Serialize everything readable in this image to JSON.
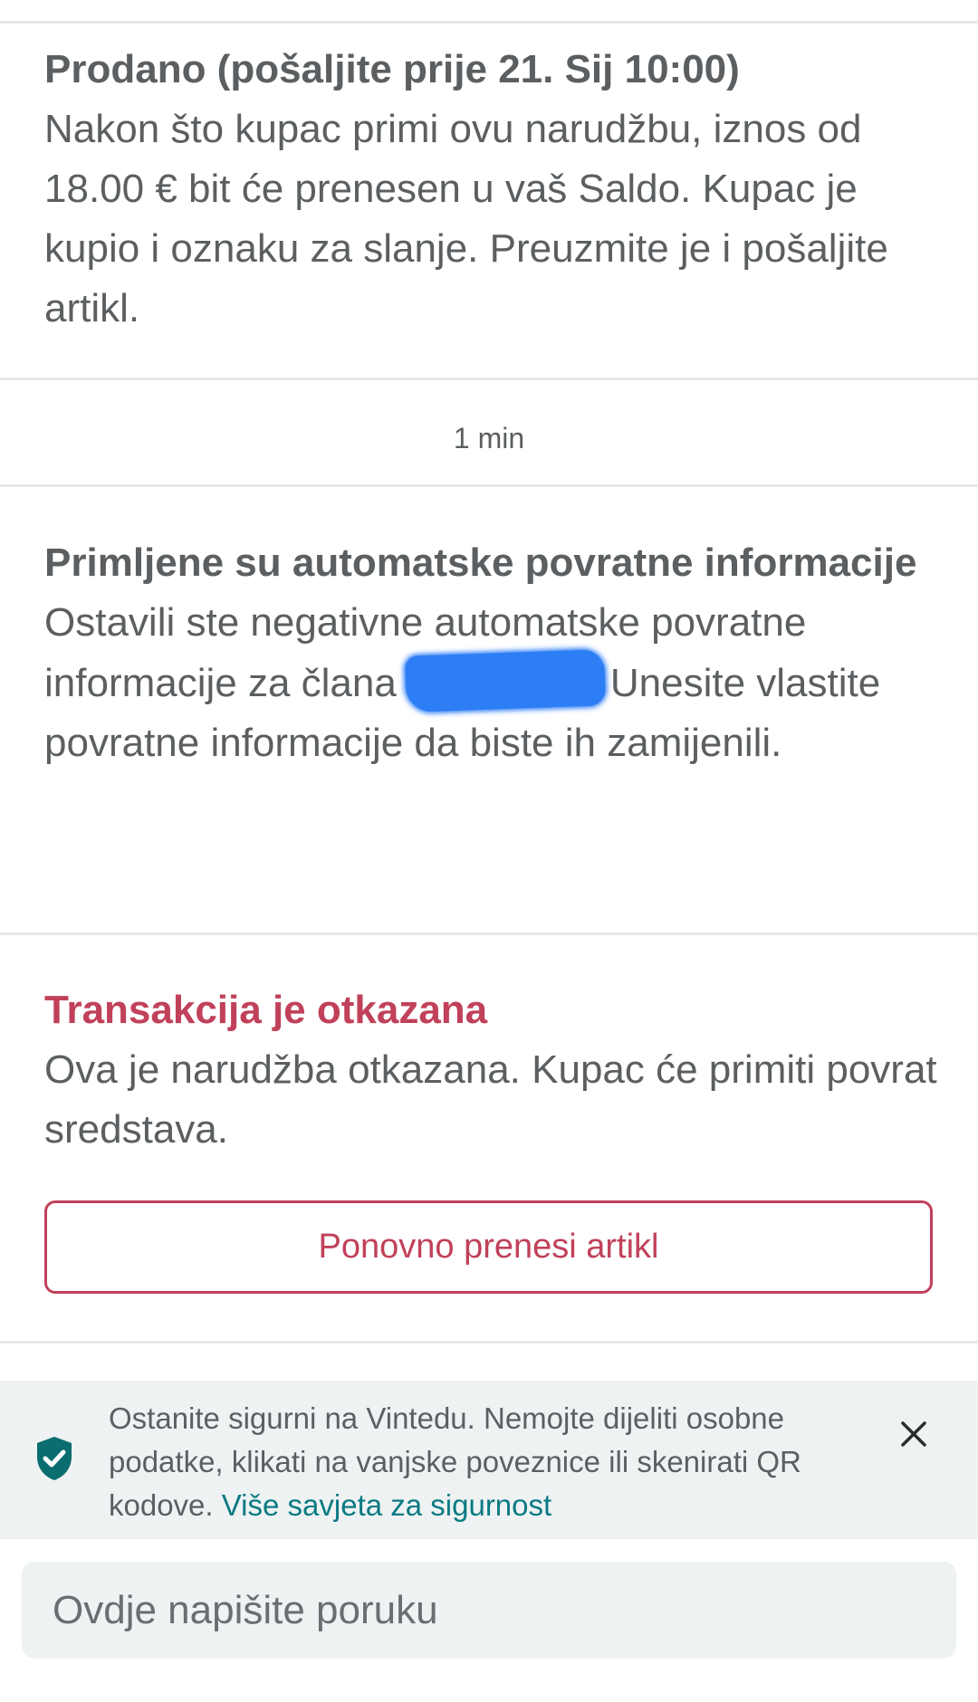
{
  "sold_message": {
    "title": "Prodano (pošaljite prije 21. Sij 10:00)",
    "body": "Nakon što kupac primi ovu narudžbu, iznos od 18.00 € bit će prenesen u vaš Saldo. Kupac je kupio i oznaku za slanje. Preuzmite je i pošaljite artikl."
  },
  "timestamp": "1 min",
  "feedback_message": {
    "title": "Primljene su automatske povratne informacije",
    "body_before": "Ostavili ste negativne automatske povratne informacije za člana",
    "body_after": "Unesite vlastite povratne informacije da biste ih zamijenili."
  },
  "cancel_message": {
    "title": "Transakcija je otkazana",
    "body": "Ova je narudžba otkazana. Kupac će primiti povrat sredstava.",
    "button_label": "Ponovno prenesi artikl"
  },
  "safety_banner": {
    "text": "Ostanite sigurni na Vintedu. Nemojte dijeliti osobne podatke, klikati na vanjske poveznice ili skenirati QR kodove.",
    "link_label": "Više savjeta za sigurnost"
  },
  "composer": {
    "placeholder": "Ovdje napišite poruku"
  },
  "colors": {
    "accent_red": "#c1415a",
    "accent_teal": "#0a7a82",
    "redaction_blue": "#2d7df5"
  },
  "icons": {
    "shield": "shield-check-icon",
    "close": "close-icon"
  }
}
